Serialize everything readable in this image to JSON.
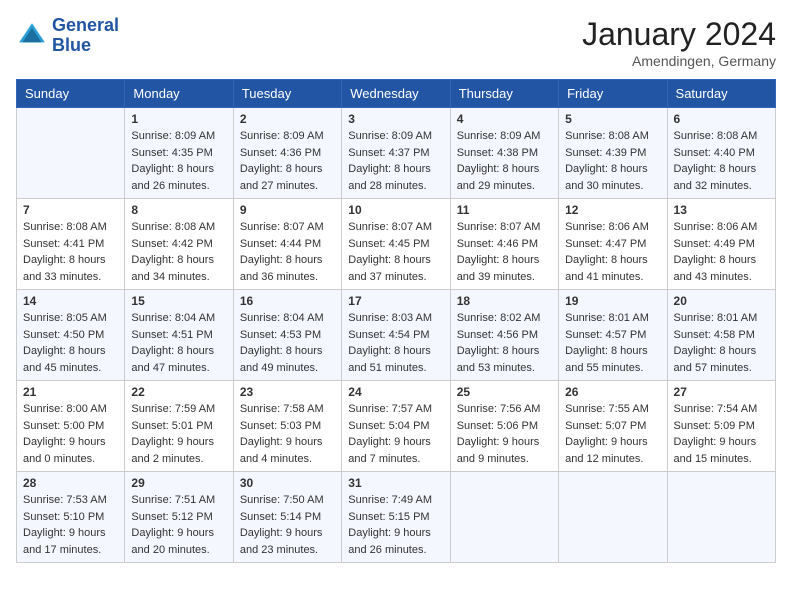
{
  "logo": {
    "line1": "General",
    "line2": "Blue"
  },
  "title": "January 2024",
  "location": "Amendingen, Germany",
  "days_of_week": [
    "Sunday",
    "Monday",
    "Tuesday",
    "Wednesday",
    "Thursday",
    "Friday",
    "Saturday"
  ],
  "weeks": [
    [
      {
        "day": "",
        "sunrise": "",
        "sunset": "",
        "daylight": ""
      },
      {
        "day": "1",
        "sunrise": "Sunrise: 8:09 AM",
        "sunset": "Sunset: 4:35 PM",
        "daylight": "Daylight: 8 hours and 26 minutes."
      },
      {
        "day": "2",
        "sunrise": "Sunrise: 8:09 AM",
        "sunset": "Sunset: 4:36 PM",
        "daylight": "Daylight: 8 hours and 27 minutes."
      },
      {
        "day": "3",
        "sunrise": "Sunrise: 8:09 AM",
        "sunset": "Sunset: 4:37 PM",
        "daylight": "Daylight: 8 hours and 28 minutes."
      },
      {
        "day": "4",
        "sunrise": "Sunrise: 8:09 AM",
        "sunset": "Sunset: 4:38 PM",
        "daylight": "Daylight: 8 hours and 29 minutes."
      },
      {
        "day": "5",
        "sunrise": "Sunrise: 8:08 AM",
        "sunset": "Sunset: 4:39 PM",
        "daylight": "Daylight: 8 hours and 30 minutes."
      },
      {
        "day": "6",
        "sunrise": "Sunrise: 8:08 AM",
        "sunset": "Sunset: 4:40 PM",
        "daylight": "Daylight: 8 hours and 32 minutes."
      }
    ],
    [
      {
        "day": "7",
        "sunrise": "Sunrise: 8:08 AM",
        "sunset": "Sunset: 4:41 PM",
        "daylight": "Daylight: 8 hours and 33 minutes."
      },
      {
        "day": "8",
        "sunrise": "Sunrise: 8:08 AM",
        "sunset": "Sunset: 4:42 PM",
        "daylight": "Daylight: 8 hours and 34 minutes."
      },
      {
        "day": "9",
        "sunrise": "Sunrise: 8:07 AM",
        "sunset": "Sunset: 4:44 PM",
        "daylight": "Daylight: 8 hours and 36 minutes."
      },
      {
        "day": "10",
        "sunrise": "Sunrise: 8:07 AM",
        "sunset": "Sunset: 4:45 PM",
        "daylight": "Daylight: 8 hours and 37 minutes."
      },
      {
        "day": "11",
        "sunrise": "Sunrise: 8:07 AM",
        "sunset": "Sunset: 4:46 PM",
        "daylight": "Daylight: 8 hours and 39 minutes."
      },
      {
        "day": "12",
        "sunrise": "Sunrise: 8:06 AM",
        "sunset": "Sunset: 4:47 PM",
        "daylight": "Daylight: 8 hours and 41 minutes."
      },
      {
        "day": "13",
        "sunrise": "Sunrise: 8:06 AM",
        "sunset": "Sunset: 4:49 PM",
        "daylight": "Daylight: 8 hours and 43 minutes."
      }
    ],
    [
      {
        "day": "14",
        "sunrise": "Sunrise: 8:05 AM",
        "sunset": "Sunset: 4:50 PM",
        "daylight": "Daylight: 8 hours and 45 minutes."
      },
      {
        "day": "15",
        "sunrise": "Sunrise: 8:04 AM",
        "sunset": "Sunset: 4:51 PM",
        "daylight": "Daylight: 8 hours and 47 minutes."
      },
      {
        "day": "16",
        "sunrise": "Sunrise: 8:04 AM",
        "sunset": "Sunset: 4:53 PM",
        "daylight": "Daylight: 8 hours and 49 minutes."
      },
      {
        "day": "17",
        "sunrise": "Sunrise: 8:03 AM",
        "sunset": "Sunset: 4:54 PM",
        "daylight": "Daylight: 8 hours and 51 minutes."
      },
      {
        "day": "18",
        "sunrise": "Sunrise: 8:02 AM",
        "sunset": "Sunset: 4:56 PM",
        "daylight": "Daylight: 8 hours and 53 minutes."
      },
      {
        "day": "19",
        "sunrise": "Sunrise: 8:01 AM",
        "sunset": "Sunset: 4:57 PM",
        "daylight": "Daylight: 8 hours and 55 minutes."
      },
      {
        "day": "20",
        "sunrise": "Sunrise: 8:01 AM",
        "sunset": "Sunset: 4:58 PM",
        "daylight": "Daylight: 8 hours and 57 minutes."
      }
    ],
    [
      {
        "day": "21",
        "sunrise": "Sunrise: 8:00 AM",
        "sunset": "Sunset: 5:00 PM",
        "daylight": "Daylight: 9 hours and 0 minutes."
      },
      {
        "day": "22",
        "sunrise": "Sunrise: 7:59 AM",
        "sunset": "Sunset: 5:01 PM",
        "daylight": "Daylight: 9 hours and 2 minutes."
      },
      {
        "day": "23",
        "sunrise": "Sunrise: 7:58 AM",
        "sunset": "Sunset: 5:03 PM",
        "daylight": "Daylight: 9 hours and 4 minutes."
      },
      {
        "day": "24",
        "sunrise": "Sunrise: 7:57 AM",
        "sunset": "Sunset: 5:04 PM",
        "daylight": "Daylight: 9 hours and 7 minutes."
      },
      {
        "day": "25",
        "sunrise": "Sunrise: 7:56 AM",
        "sunset": "Sunset: 5:06 PM",
        "daylight": "Daylight: 9 hours and 9 minutes."
      },
      {
        "day": "26",
        "sunrise": "Sunrise: 7:55 AM",
        "sunset": "Sunset: 5:07 PM",
        "daylight": "Daylight: 9 hours and 12 minutes."
      },
      {
        "day": "27",
        "sunrise": "Sunrise: 7:54 AM",
        "sunset": "Sunset: 5:09 PM",
        "daylight": "Daylight: 9 hours and 15 minutes."
      }
    ],
    [
      {
        "day": "28",
        "sunrise": "Sunrise: 7:53 AM",
        "sunset": "Sunset: 5:10 PM",
        "daylight": "Daylight: 9 hours and 17 minutes."
      },
      {
        "day": "29",
        "sunrise": "Sunrise: 7:51 AM",
        "sunset": "Sunset: 5:12 PM",
        "daylight": "Daylight: 9 hours and 20 minutes."
      },
      {
        "day": "30",
        "sunrise": "Sunrise: 7:50 AM",
        "sunset": "Sunset: 5:14 PM",
        "daylight": "Daylight: 9 hours and 23 minutes."
      },
      {
        "day": "31",
        "sunrise": "Sunrise: 7:49 AM",
        "sunset": "Sunset: 5:15 PM",
        "daylight": "Daylight: 9 hours and 26 minutes."
      },
      {
        "day": "",
        "sunrise": "",
        "sunset": "",
        "daylight": ""
      },
      {
        "day": "",
        "sunrise": "",
        "sunset": "",
        "daylight": ""
      },
      {
        "day": "",
        "sunrise": "",
        "sunset": "",
        "daylight": ""
      }
    ]
  ]
}
